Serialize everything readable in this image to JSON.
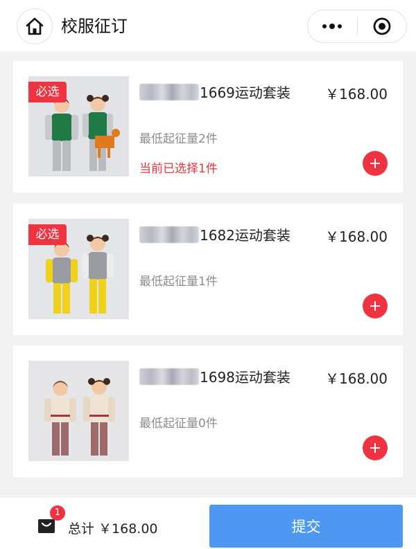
{
  "header": {
    "title": "校服征订",
    "home_icon": "home-icon",
    "more_icon": "more-dots-icon",
    "close_icon": "record-circle-icon"
  },
  "products": [
    {
      "name": "1669运动套装",
      "price": "￥168.00",
      "min_qty": "最低起征量2件",
      "tag": "必选",
      "selected": "当前已选择1件",
      "jacket_color": "#1f7a45",
      "sleeve_color": "#c8c9cc",
      "pants_color": "#b9bbbf"
    },
    {
      "name": "1682运动套装",
      "price": "￥168.00",
      "min_qty": "最低起征量1件",
      "tag": "必选",
      "jacket_color": "#9a9ca1",
      "sleeve_color": "#f1d21a",
      "pants_color": "#f1d21a"
    },
    {
      "name": "1698运动套装",
      "price": "￥168.00",
      "min_qty": "最低起征量0件",
      "jacket_color": "#efe3d3",
      "sleeve_color": "#e7d8c4",
      "pants_color": "#9c6a6a"
    }
  ],
  "footer": {
    "cart_count": "1",
    "total_label": "总计",
    "total_amount": "￥168.00",
    "submit_label": "提交"
  },
  "colors": {
    "accent_red": "#ef3340",
    "submit_blue": "#4f98f2",
    "muted_text": "#8c8c8c"
  }
}
